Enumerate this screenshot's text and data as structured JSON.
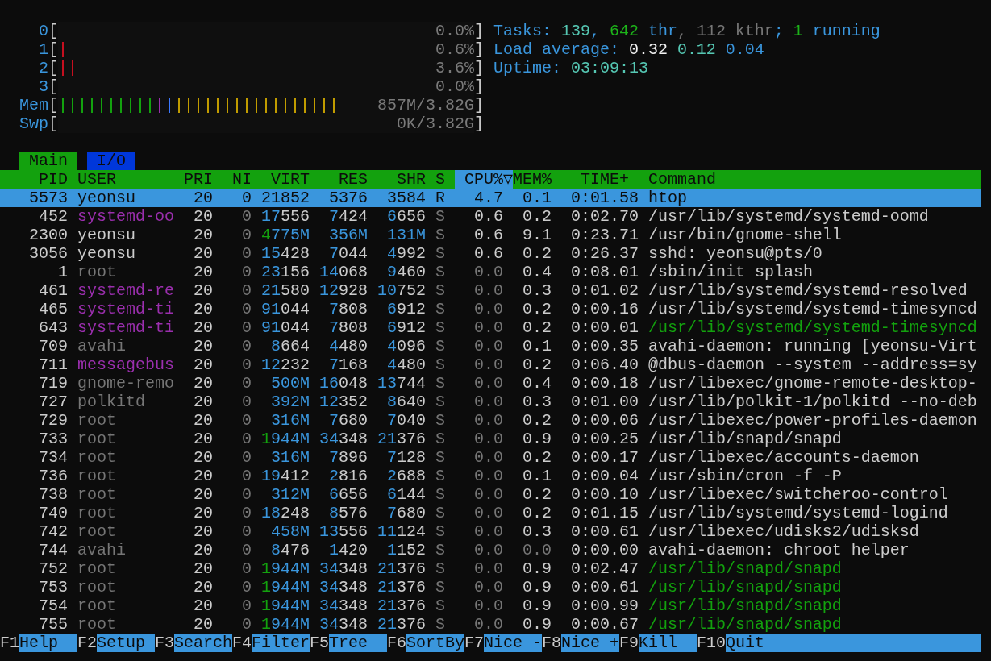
{
  "meters": {
    "cpus": [
      {
        "label": "0",
        "open": "[",
        "level": 0,
        "reading": "0.0%",
        "close": "]"
      },
      {
        "label": "1",
        "open": "[",
        "level": 0.023,
        "reading": "0.6%",
        "close": "]"
      },
      {
        "label": "2",
        "open": "[",
        "level": 0.047,
        "reading": "3.6%",
        "close": "]"
      },
      {
        "label": "3",
        "open": "[",
        "level": 0,
        "reading": "0.0%",
        "close": "]"
      }
    ],
    "memory": {
      "label": "Mem",
      "open": "[",
      "level": 0.674,
      "bars": [
        {
          "color": "#13a10e"
        },
        {
          "color": "#13a10e"
        },
        {
          "color": "#13a10e"
        },
        {
          "color": "#13a10e"
        },
        {
          "color": "#13a10e"
        },
        {
          "color": "#13a10e"
        },
        {
          "color": "#13a10e"
        },
        {
          "color": "#13a10e"
        },
        {
          "color": "#13a10e"
        },
        {
          "color": "#13a10e"
        },
        {
          "color": "#9b2fae"
        },
        {
          "color": "#3b78ff"
        },
        {
          "color": "#c19c00"
        },
        {
          "color": "#c19c00"
        },
        {
          "color": "#c19c00"
        },
        {
          "color": "#c19c00"
        },
        {
          "color": "#c19c00"
        },
        {
          "color": "#c19c00"
        },
        {
          "color": "#c19c00"
        },
        {
          "color": "#c19c00"
        },
        {
          "color": "#c19c00"
        },
        {
          "color": "#c19c00"
        },
        {
          "color": "#c19c00"
        },
        {
          "color": "#c19c00"
        },
        {
          "color": "#c19c00"
        },
        {
          "color": "#c19c00"
        },
        {
          "color": "#c19c00"
        },
        {
          "color": "#c19c00"
        },
        {
          "color": "#c19c00"
        }
      ],
      "reading": "857M/3.82G",
      "close": "]"
    },
    "swap": {
      "label": "Swp",
      "open": "[",
      "level": 0,
      "reading": "0K/3.82G",
      "close": "]"
    }
  },
  "summary": [
    {
      "parts": [
        {
          "text": "Tasks: ",
          "color": "#3a96dd"
        },
        {
          "text": "139",
          "color": "#56c8b4"
        },
        {
          "text": ", ",
          "color": "#3a96dd"
        },
        {
          "text": "642",
          "color": "#1db31a"
        },
        {
          "text": " thr",
          "color": "#3a96dd"
        },
        {
          "text": ", 112 kthr",
          "color": "#767676"
        },
        {
          "text": "; ",
          "color": "#3a96dd"
        },
        {
          "text": "1",
          "color": "#1db31a"
        },
        {
          "text": " running",
          "color": "#3a96dd"
        }
      ]
    },
    {
      "parts": [
        {
          "text": "Load average: ",
          "color": "#3a96dd"
        },
        {
          "text": "0.32",
          "color": "#f2f2f2"
        },
        {
          "text": " 0.12",
          "color": "#56c8b4"
        },
        {
          "text": " 0.04",
          "color": "#3a96dd"
        }
      ]
    },
    {
      "parts": [
        {
          "text": "Uptime: ",
          "color": "#3a96dd"
        },
        {
          "text": "03:09:13",
          "color": "#56c8b4"
        }
      ]
    }
  ],
  "tabs": [
    {
      "label": "Main",
      "selected": true
    },
    {
      "label": "I/O",
      "selected": false
    }
  ],
  "table": {
    "columns": [
      {
        "label": "PID",
        "sorted": false
      },
      {
        "label": "USER",
        "sorted": false
      },
      {
        "label": "PRI",
        "sorted": false
      },
      {
        "label": "NI",
        "sorted": false
      },
      {
        "label": "VIRT",
        "sorted": false
      },
      {
        "label": "RES",
        "sorted": false
      },
      {
        "label": "SHR",
        "sorted": false
      },
      {
        "label": "S",
        "sorted": false
      },
      {
        "label": "CPU%▽",
        "sorted": true
      },
      {
        "label": "MEM%",
        "sorted": false
      },
      {
        "label": "TIME+",
        "sorted": false
      },
      {
        "label": "Command",
        "sorted": false
      }
    ],
    "rows": [
      {
        "selected": true,
        "pid": "5573",
        "user": {
          "text": "yeonsu"
        },
        "pri": "20",
        "ni": "0",
        "virt": "21852",
        "res": "5376",
        "shr": "3584",
        "state": "R",
        "cpu": "4.7",
        "mem": "0.1",
        "time": "0:01.58",
        "command": "htop"
      },
      {
        "selected": false,
        "pid": "452",
        "user": {
          "text": "systemd-oo",
          "color": "#9b2fae"
        },
        "pri": "20",
        "ni": "0",
        "virt": "17556",
        "res": "7424",
        "shr": "6656",
        "state": "S",
        "cpu": "0.6",
        "mem": "0.2",
        "time": "0:02.70",
        "command": "/usr/lib/systemd/systemd-oomd",
        "thread": false,
        "dim": {
          "ni": true,
          "state": true,
          "cpu": false,
          "mem": false
        }
      },
      {
        "selected": false,
        "pid": "2300",
        "user": {
          "text": "yeonsu",
          "color": "#cccccc"
        },
        "pri": "20",
        "ni": "0",
        "virt": "4775M",
        "res": "356M",
        "shr": "131M",
        "state": "S",
        "cpu": "0.6",
        "mem": "9.1",
        "time": "0:23.71",
        "command": "/usr/bin/gnome-shell",
        "thread": false,
        "dim": {
          "ni": true,
          "state": true,
          "cpu": false,
          "mem": false
        }
      },
      {
        "selected": false,
        "pid": "3056",
        "user": {
          "text": "yeonsu",
          "color": "#cccccc"
        },
        "pri": "20",
        "ni": "0",
        "virt": "15428",
        "res": "7044",
        "shr": "4992",
        "state": "S",
        "cpu": "0.6",
        "mem": "0.2",
        "time": "0:26.37",
        "command": "sshd: yeonsu@pts/0",
        "thread": false,
        "dim": {
          "ni": true,
          "state": true,
          "cpu": false,
          "mem": false
        }
      },
      {
        "selected": false,
        "pid": "1",
        "user": {
          "text": "root",
          "color": "#767676"
        },
        "pri": "20",
        "ni": "0",
        "virt": "23156",
        "res": "14068",
        "shr": "9460",
        "state": "S",
        "cpu": "0.0",
        "mem": "0.4",
        "time": "0:08.01",
        "command": "/sbin/init splash",
        "thread": false,
        "dim": {
          "ni": true,
          "state": true,
          "cpu": true,
          "mem": false
        }
      },
      {
        "selected": false,
        "pid": "461",
        "user": {
          "text": "systemd-re",
          "color": "#9b2fae"
        },
        "pri": "20",
        "ni": "0",
        "virt": "21580",
        "res": "12928",
        "shr": "10752",
        "state": "S",
        "cpu": "0.0",
        "mem": "0.3",
        "time": "0:01.02",
        "command": "/usr/lib/systemd/systemd-resolved",
        "thread": false,
        "dim": {
          "ni": true,
          "state": true,
          "cpu": true,
          "mem": false
        }
      },
      {
        "selected": false,
        "pid": "465",
        "user": {
          "text": "systemd-ti",
          "color": "#9b2fae"
        },
        "pri": "20",
        "ni": "0",
        "virt": "91044",
        "res": "7808",
        "shr": "6912",
        "state": "S",
        "cpu": "0.0",
        "mem": "0.2",
        "time": "0:00.16",
        "command": "/usr/lib/systemd/systemd-timesyncd",
        "thread": false,
        "dim": {
          "ni": true,
          "state": true,
          "cpu": true,
          "mem": false
        }
      },
      {
        "selected": false,
        "pid": "643",
        "user": {
          "text": "systemd-ti",
          "color": "#9b2fae"
        },
        "pri": "20",
        "ni": "0",
        "virt": "91044",
        "res": "7808",
        "shr": "6912",
        "state": "S",
        "cpu": "0.0",
        "mem": "0.2",
        "time": "0:00.01",
        "command": "/usr/lib/systemd/systemd-timesyncd",
        "thread": true,
        "dim": {
          "ni": true,
          "state": true,
          "cpu": true,
          "mem": false
        }
      },
      {
        "selected": false,
        "pid": "709",
        "user": {
          "text": "avahi",
          "color": "#767676"
        },
        "pri": "20",
        "ni": "0",
        "virt": "8664",
        "res": "4480",
        "shr": "4096",
        "state": "S",
        "cpu": "0.0",
        "mem": "0.1",
        "time": "0:00.35",
        "command": "avahi-daemon: running [yeonsu-Virt",
        "thread": false,
        "dim": {
          "ni": true,
          "state": true,
          "cpu": true,
          "mem": false
        }
      },
      {
        "selected": false,
        "pid": "711",
        "user": {
          "text": "messagebus",
          "color": "#9b2fae"
        },
        "pri": "20",
        "ni": "0",
        "virt": "12232",
        "res": "7168",
        "shr": "4480",
        "state": "S",
        "cpu": "0.0",
        "mem": "0.2",
        "time": "0:06.40",
        "command": "@dbus-daemon --system --address=sy",
        "thread": false,
        "dim": {
          "ni": true,
          "state": true,
          "cpu": true,
          "mem": false
        }
      },
      {
        "selected": false,
        "pid": "719",
        "user": {
          "text": "gnome-remo",
          "color": "#767676"
        },
        "pri": "20",
        "ni": "0",
        "virt": "500M",
        "res": "16048",
        "shr": "13744",
        "state": "S",
        "cpu": "0.0",
        "mem": "0.4",
        "time": "0:00.18",
        "command": "/usr/libexec/gnome-remote-desktop-",
        "thread": false,
        "dim": {
          "ni": true,
          "state": true,
          "cpu": true,
          "mem": false
        }
      },
      {
        "selected": false,
        "pid": "727",
        "user": {
          "text": "polkitd",
          "color": "#767676"
        },
        "pri": "20",
        "ni": "0",
        "virt": "392M",
        "res": "12352",
        "shr": "8640",
        "state": "S",
        "cpu": "0.0",
        "mem": "0.3",
        "time": "0:01.00",
        "command": "/usr/lib/polkit-1/polkitd --no-deb",
        "thread": false,
        "dim": {
          "ni": true,
          "state": true,
          "cpu": true,
          "mem": false
        }
      },
      {
        "selected": false,
        "pid": "729",
        "user": {
          "text": "root",
          "color": "#767676"
        },
        "pri": "20",
        "ni": "0",
        "virt": "316M",
        "res": "7680",
        "shr": "7040",
        "state": "S",
        "cpu": "0.0",
        "mem": "0.2",
        "time": "0:00.06",
        "command": "/usr/libexec/power-profiles-daemon",
        "thread": false,
        "dim": {
          "ni": true,
          "state": true,
          "cpu": true,
          "mem": false
        }
      },
      {
        "selected": false,
        "pid": "733",
        "user": {
          "text": "root",
          "color": "#767676"
        },
        "pri": "20",
        "ni": "0",
        "virt": "1944M",
        "res": "34348",
        "shr": "21376",
        "state": "S",
        "cpu": "0.0",
        "mem": "0.9",
        "time": "0:00.25",
        "command": "/usr/lib/snapd/snapd",
        "thread": false,
        "dim": {
          "ni": true,
          "state": true,
          "cpu": true,
          "mem": false
        }
      },
      {
        "selected": false,
        "pid": "734",
        "user": {
          "text": "root",
          "color": "#767676"
        },
        "pri": "20",
        "ni": "0",
        "virt": "316M",
        "res": "7896",
        "shr": "7128",
        "state": "S",
        "cpu": "0.0",
        "mem": "0.2",
        "time": "0:00.17",
        "command": "/usr/libexec/accounts-daemon",
        "thread": false,
        "dim": {
          "ni": true,
          "state": true,
          "cpu": true,
          "mem": false
        }
      },
      {
        "selected": false,
        "pid": "736",
        "user": {
          "text": "root",
          "color": "#767676"
        },
        "pri": "20",
        "ni": "0",
        "virt": "19412",
        "res": "2816",
        "shr": "2688",
        "state": "S",
        "cpu": "0.0",
        "mem": "0.1",
        "time": "0:00.04",
        "command": "/usr/sbin/cron -f -P",
        "thread": false,
        "dim": {
          "ni": true,
          "state": true,
          "cpu": true,
          "mem": false
        }
      },
      {
        "selected": false,
        "pid": "738",
        "user": {
          "text": "root",
          "color": "#767676"
        },
        "pri": "20",
        "ni": "0",
        "virt": "312M",
        "res": "6656",
        "shr": "6144",
        "state": "S",
        "cpu": "0.0",
        "mem": "0.2",
        "time": "0:00.10",
        "command": "/usr/libexec/switcheroo-control",
        "thread": false,
        "dim": {
          "ni": true,
          "state": true,
          "cpu": true,
          "mem": false
        }
      },
      {
        "selected": false,
        "pid": "740",
        "user": {
          "text": "root",
          "color": "#767676"
        },
        "pri": "20",
        "ni": "0",
        "virt": "18248",
        "res": "8576",
        "shr": "7680",
        "state": "S",
        "cpu": "0.0",
        "mem": "0.2",
        "time": "0:01.15",
        "command": "/usr/lib/systemd/systemd-logind",
        "thread": false,
        "dim": {
          "ni": true,
          "state": true,
          "cpu": true,
          "mem": false
        }
      },
      {
        "selected": false,
        "pid": "742",
        "user": {
          "text": "root",
          "color": "#767676"
        },
        "pri": "20",
        "ni": "0",
        "virt": "458M",
        "res": "13556",
        "shr": "11124",
        "state": "S",
        "cpu": "0.0",
        "mem": "0.3",
        "time": "0:00.61",
        "command": "/usr/libexec/udisks2/udisksd",
        "thread": false,
        "dim": {
          "ni": true,
          "state": true,
          "cpu": true,
          "mem": false
        }
      },
      {
        "selected": false,
        "pid": "744",
        "user": {
          "text": "avahi",
          "color": "#767676"
        },
        "pri": "20",
        "ni": "0",
        "virt": "8476",
        "res": "1420",
        "shr": "1152",
        "state": "S",
        "cpu": "0.0",
        "mem": "0.0",
        "time": "0:00.00",
        "command": "avahi-daemon: chroot helper",
        "thread": false,
        "dim": {
          "ni": true,
          "state": true,
          "cpu": true,
          "mem": true
        }
      },
      {
        "selected": false,
        "pid": "752",
        "user": {
          "text": "root",
          "color": "#767676"
        },
        "pri": "20",
        "ni": "0",
        "virt": "1944M",
        "res": "34348",
        "shr": "21376",
        "state": "S",
        "cpu": "0.0",
        "mem": "0.9",
        "time": "0:02.47",
        "command": "/usr/lib/snapd/snapd",
        "thread": true,
        "dim": {
          "ni": true,
          "state": true,
          "cpu": true,
          "mem": false
        }
      },
      {
        "selected": false,
        "pid": "753",
        "user": {
          "text": "root",
          "color": "#767676"
        },
        "pri": "20",
        "ni": "0",
        "virt": "1944M",
        "res": "34348",
        "shr": "21376",
        "state": "S",
        "cpu": "0.0",
        "mem": "0.9",
        "time": "0:00.61",
        "command": "/usr/lib/snapd/snapd",
        "thread": true,
        "dim": {
          "ni": true,
          "state": true,
          "cpu": true,
          "mem": false
        }
      },
      {
        "selected": false,
        "pid": "754",
        "user": {
          "text": "root",
          "color": "#767676"
        },
        "pri": "20",
        "ni": "0",
        "virt": "1944M",
        "res": "34348",
        "shr": "21376",
        "state": "S",
        "cpu": "0.0",
        "mem": "0.9",
        "time": "0:00.99",
        "command": "/usr/lib/snapd/snapd",
        "thread": true,
        "dim": {
          "ni": true,
          "state": true,
          "cpu": true,
          "mem": false
        }
      },
      {
        "selected": false,
        "pid": "755",
        "user": {
          "text": "root",
          "color": "#767676"
        },
        "pri": "20",
        "ni": "0",
        "virt": "1944M",
        "res": "34348",
        "shr": "21376",
        "state": "S",
        "cpu": "0.0",
        "mem": "0.9",
        "time": "0:00.67",
        "command": "/usr/lib/snapd/snapd",
        "thread": true,
        "dim": {
          "ni": true,
          "state": true,
          "cpu": true,
          "mem": false
        }
      }
    ]
  },
  "function_bar": [
    {
      "key": "F1",
      "label": "Help"
    },
    {
      "key": "F2",
      "label": "Setup"
    },
    {
      "key": "F3",
      "label": "Search"
    },
    {
      "key": "F4",
      "label": "Filter"
    },
    {
      "key": "F5",
      "label": "Tree"
    },
    {
      "key": "F6",
      "label": "SortBy"
    },
    {
      "key": "F7",
      "label": "Nice -"
    },
    {
      "key": "F8",
      "label": "Nice +"
    },
    {
      "key": "F9",
      "label": "Kill"
    },
    {
      "key": "F10",
      "label": "Quit"
    }
  ]
}
